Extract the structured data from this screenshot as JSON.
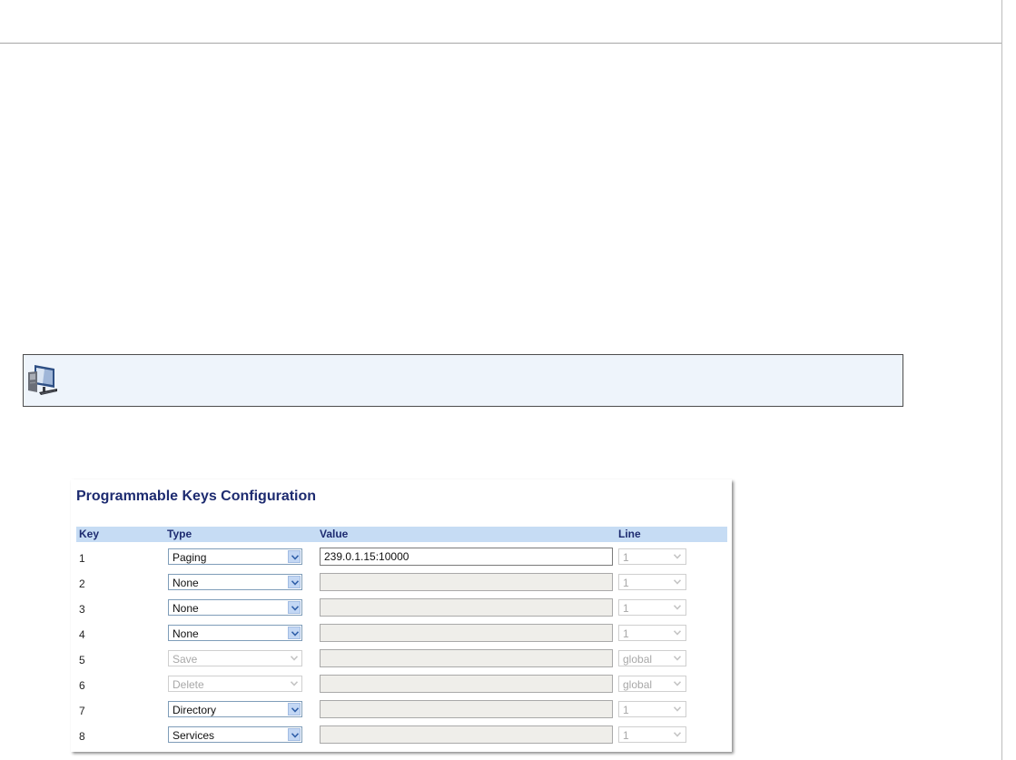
{
  "panel": {
    "title": "Programmable Keys Configuration",
    "headers": {
      "key": "Key",
      "type": "Type",
      "value": "Value",
      "line": "Line"
    }
  },
  "rows": [
    {
      "key": "1",
      "type": "Paging",
      "type_enabled": true,
      "value": "239.0.1.15:10000",
      "value_enabled": true,
      "line": "1"
    },
    {
      "key": "2",
      "type": "None",
      "type_enabled": true,
      "value": "",
      "value_enabled": false,
      "line": "1"
    },
    {
      "key": "3",
      "type": "None",
      "type_enabled": true,
      "value": "",
      "value_enabled": false,
      "line": "1"
    },
    {
      "key": "4",
      "type": "None",
      "type_enabled": true,
      "value": "",
      "value_enabled": false,
      "line": "1"
    },
    {
      "key": "5",
      "type": "Save",
      "type_enabled": false,
      "value": "",
      "value_enabled": false,
      "line": "global"
    },
    {
      "key": "6",
      "type": "Delete",
      "type_enabled": false,
      "value": "",
      "value_enabled": false,
      "line": "global"
    },
    {
      "key": "7",
      "type": "Directory",
      "type_enabled": true,
      "value": "",
      "value_enabled": false,
      "line": "1"
    },
    {
      "key": "8",
      "type": "Services",
      "type_enabled": true,
      "value": "",
      "value_enabled": false,
      "line": "1"
    }
  ],
  "icons": {
    "note": "computer-monitor-icon",
    "dropdown": "chevron-down-icon"
  },
  "colors": {
    "title": "#1d2b70",
    "header_bg": "#c6dcf4",
    "note_bg": "#eef4fb",
    "disabled_input": "#efeeea"
  }
}
